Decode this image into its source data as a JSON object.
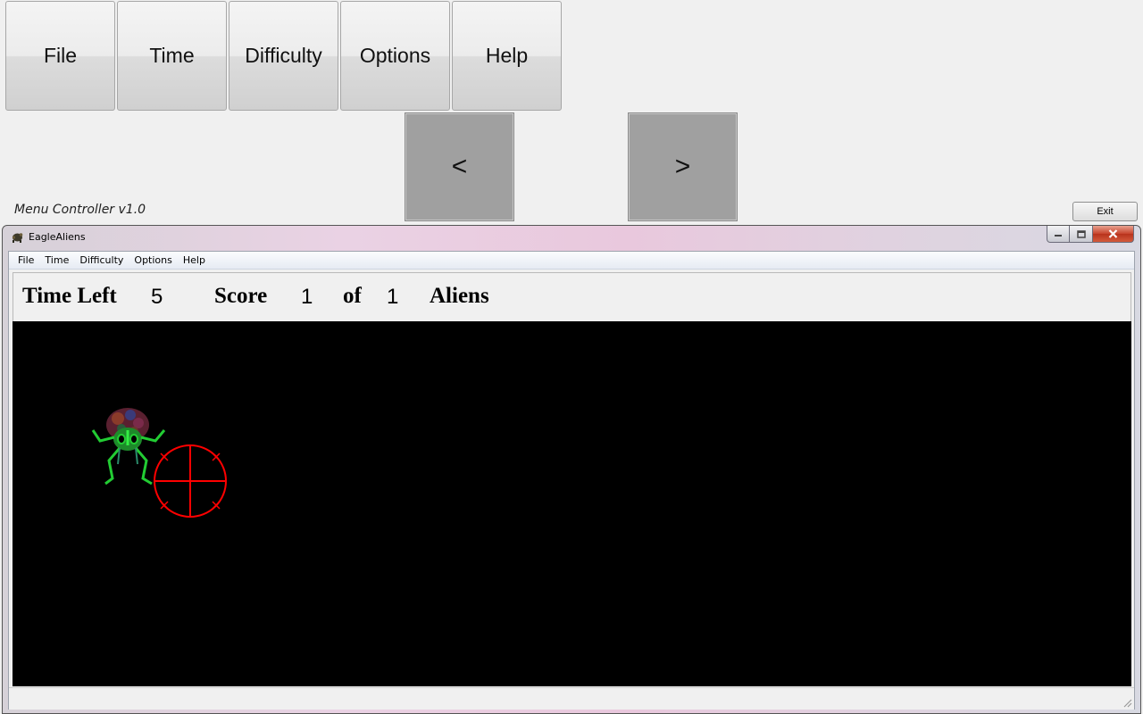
{
  "controller": {
    "menu_buttons": [
      "File",
      "Time",
      "Difficulty",
      "Options",
      "Help"
    ],
    "prev_label": "<",
    "next_label": ">",
    "version_label": "Menu Controller v1.0",
    "exit_label": "Exit"
  },
  "window": {
    "title": "EagleAliens",
    "icon": "turtle-app-icon",
    "minimize_icon": "minimize-icon",
    "maximize_icon": "maximize-icon",
    "close_icon": "close-icon",
    "menu": [
      "File",
      "Time",
      "Difficulty",
      "Options",
      "Help"
    ]
  },
  "hud": {
    "time_left_label": "Time Left",
    "time_left_value": "5",
    "score_label": "Score",
    "score_value": "1",
    "of_label": "of",
    "total_value": "1",
    "aliens_label": "Aliens"
  },
  "game": {
    "background_color": "#000000",
    "crosshair_color": "#ff0000",
    "sprites": [
      "alien-sprite",
      "crosshair-icon"
    ]
  }
}
